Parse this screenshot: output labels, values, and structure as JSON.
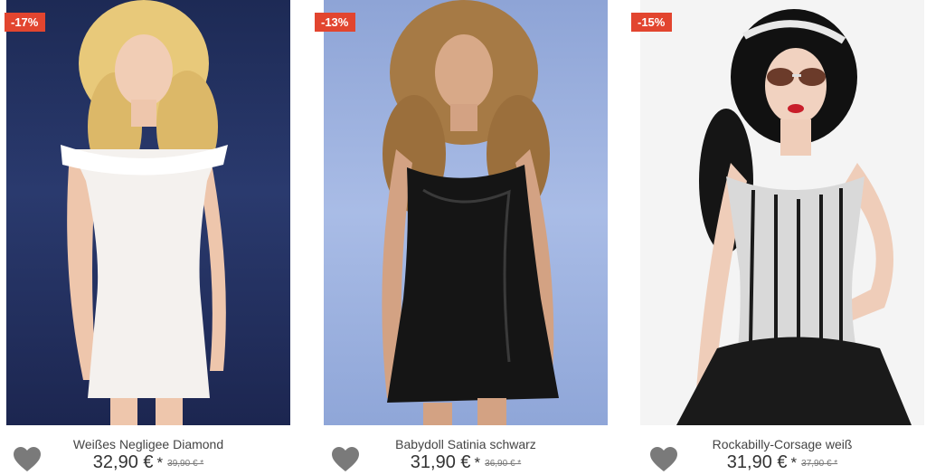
{
  "products": [
    {
      "discount_badge": "-17%",
      "name": "Weißes Negligee Diamond",
      "price": "32,90 €",
      "price_marker": "*",
      "old_price": "39,90 € *",
      "wishlist_icon": "heart-icon"
    },
    {
      "discount_badge": "-13%",
      "name": "Babydoll Satinia schwarz",
      "price": "31,90 €",
      "price_marker": "*",
      "old_price": "36,90 € *",
      "wishlist_icon": "heart-icon"
    },
    {
      "discount_badge": "-15%",
      "name": "Rockabilly-Corsage weiß",
      "price": "31,90 €",
      "price_marker": "*",
      "old_price": "37,90 € *",
      "wishlist_icon": "heart-icon"
    }
  ],
  "colors": {
    "badge_background": "#e2452f",
    "heart": "#7a7a7a",
    "text": "#444444"
  }
}
